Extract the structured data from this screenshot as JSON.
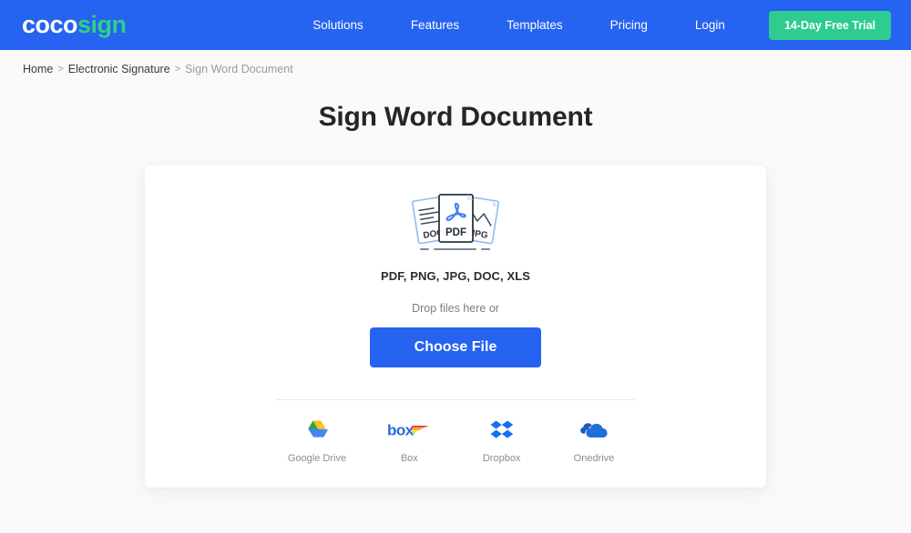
{
  "header": {
    "logo": {
      "part1": "coco",
      "part2": "sign",
      "color1": "#ffffff",
      "color2": "#2fd086"
    },
    "background_color": "#2563f0",
    "nav": [
      {
        "label": "Solutions",
        "name": "nav-solutions"
      },
      {
        "label": "Features",
        "name": "nav-features"
      },
      {
        "label": "Templates",
        "name": "nav-templates"
      },
      {
        "label": "Pricing",
        "name": "nav-pricing"
      },
      {
        "label": "Login",
        "name": "nav-login"
      }
    ],
    "cta": {
      "label": "14-Day Free Trial",
      "color": "#2ecc8f"
    }
  },
  "breadcrumb": {
    "home": "Home",
    "sep1": ">",
    "section": "Electronic Signature",
    "sep2": ">",
    "current": "Sign Word Document"
  },
  "page_title": "Sign Word Document",
  "upload_card": {
    "file_icon": {
      "name": "document-formats-icon",
      "left_label": "DOC",
      "center_label": "PDF",
      "right_label": "JPG"
    },
    "formats": "PDF, PNG, JPG, DOC, XLS",
    "drop_text": "Drop files here or",
    "choose_file_label": "Choose File",
    "choose_file_color": "#2563f0",
    "cloud_services": [
      {
        "label": "Google Drive",
        "icon": "google-drive-icon"
      },
      {
        "label": "Box",
        "icon": "box-icon"
      },
      {
        "label": "Dropbox",
        "icon": "dropbox-icon"
      },
      {
        "label": "Onedrive",
        "icon": "onedrive-icon"
      }
    ]
  },
  "colors": {
    "page_background": "#fafafa",
    "card_background": "#ffffff",
    "primary_blue": "#2563f0",
    "accent_green": "#2ecc8f",
    "text_dark": "#262626",
    "text_muted": "#8d8d8d"
  }
}
